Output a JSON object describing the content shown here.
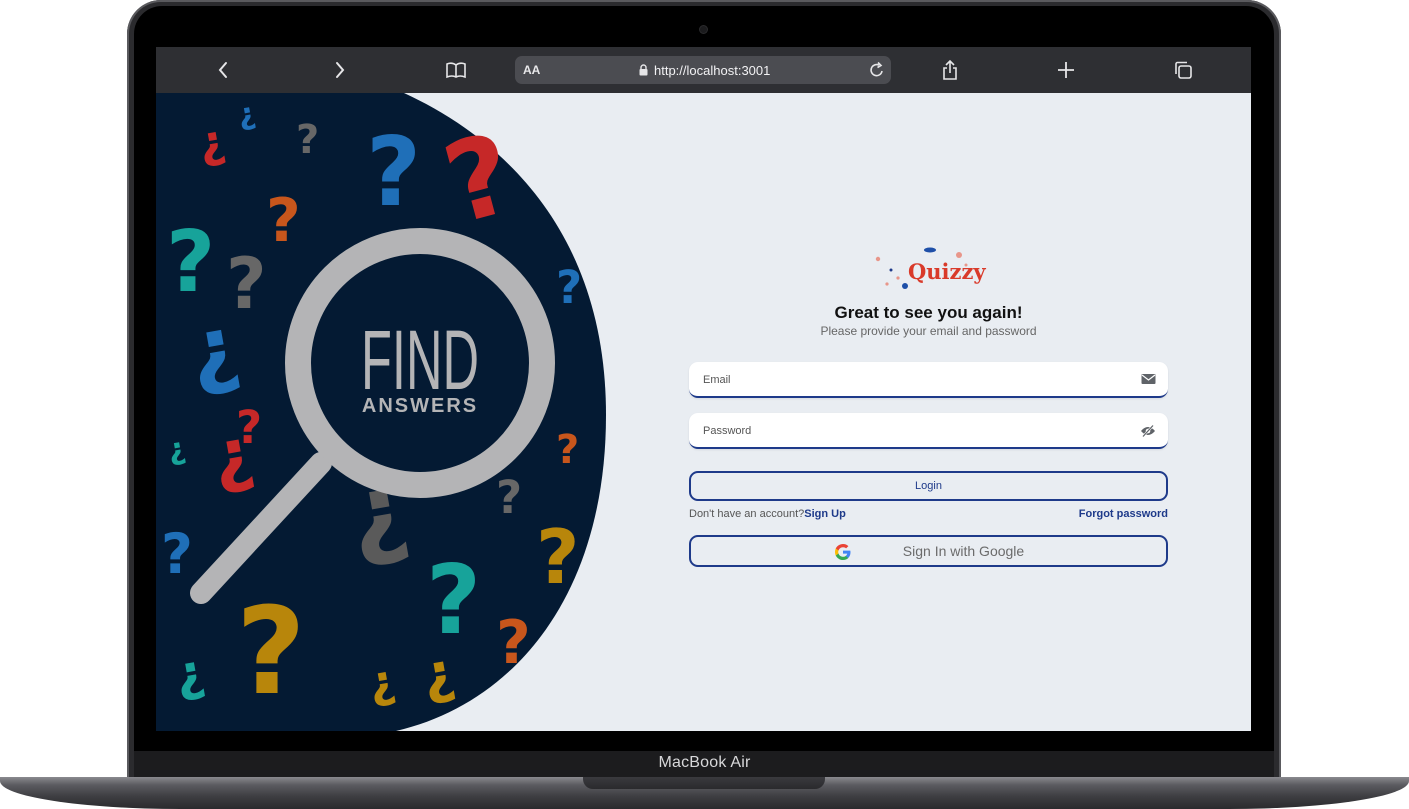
{
  "device": {
    "model_label": "MacBook Air"
  },
  "browser": {
    "aa_label": "AA",
    "url": "http://localhost:3001",
    "icons": [
      "chevron-left-icon",
      "chevron-right-icon",
      "book-icon",
      "lock-icon",
      "reload-icon",
      "share-icon",
      "plus-icon",
      "tabs-icon"
    ]
  },
  "hero": {
    "word1": "FIND",
    "word2": "ANSWERS"
  },
  "login": {
    "logo_text": "Quizzy",
    "title": "Great to see you again!",
    "subtitle": "Please provide your email and password",
    "email_label": "Email",
    "password_label": "Password",
    "login_label": "Login",
    "no_account_text": "Don't have an account?",
    "signup_label": "Sign Up",
    "forgot_label": "Forgot password",
    "google_label": "Sign In with Google"
  },
  "colors": {
    "accent": "#1e3a8a",
    "brand": "#d93a2a",
    "hero_bg": "#041a33",
    "screen_bg": "#e9edf2"
  }
}
